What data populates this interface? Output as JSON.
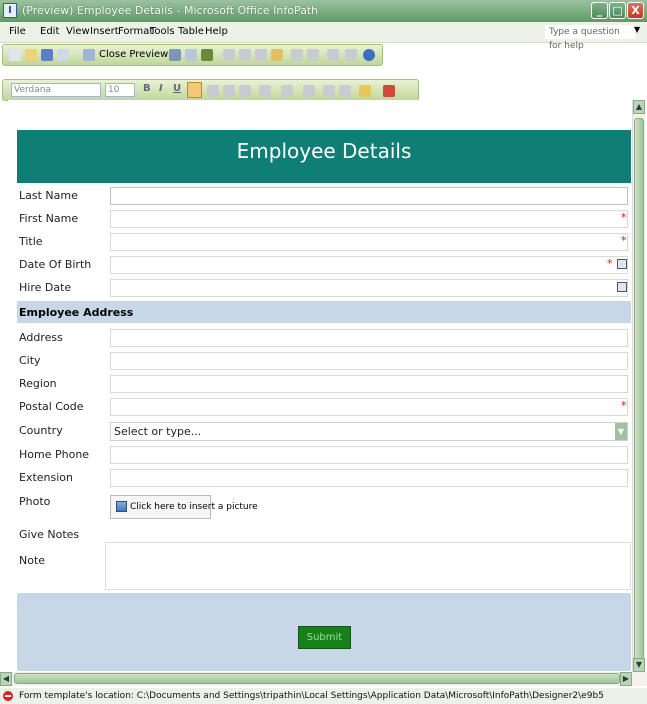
{
  "window": {
    "title": "(Preview) Employee Details - Microsoft Office InfoPath",
    "app_icon": "infopath-icon",
    "controls": {
      "minimize": "_",
      "maximize": "□",
      "close": "X"
    }
  },
  "menu": {
    "items": [
      "File",
      "Edit",
      "View",
      "Insert",
      "Format",
      "Tools",
      "Table",
      "Help"
    ],
    "help_placeholder": "Type a question for help"
  },
  "toolbar": {
    "close_preview_label": "Close Preview",
    "font_name": "Verdana",
    "font_size": "10",
    "bold": "B",
    "italic": "I",
    "underline": "U"
  },
  "form": {
    "title": "Employee Details",
    "fields": {
      "last_name": "Last Name",
      "first_name": "First Name",
      "title": "Title",
      "date_of_birth": "Date Of Birth",
      "hire_date": "Hire Date"
    },
    "address_section": "Employee Address",
    "address_fields": {
      "address": "Address",
      "city": "City",
      "region": "Region",
      "postal_code": "Postal Code",
      "country": "Country",
      "home_phone": "Home Phone",
      "extension": "Extension"
    },
    "country_placeholder": "Select or type...",
    "photo_label": "Photo",
    "photo_button": "Click here to insert a picture",
    "give_notes": "Give Notes",
    "note_label": "Note",
    "required_marker": "*",
    "submit_label": "Submit"
  },
  "status": {
    "text": "Form template's location: C:\\Documents and Settings\\tripathin\\Local Settings\\Application Data\\Microsoft\\InfoPath\\Designer2\\e9b5"
  },
  "colors": {
    "header_bg": "#0f7f76",
    "section_bg": "#c8d7e8",
    "submit_bg": "#188018",
    "required": "#dd1111"
  }
}
